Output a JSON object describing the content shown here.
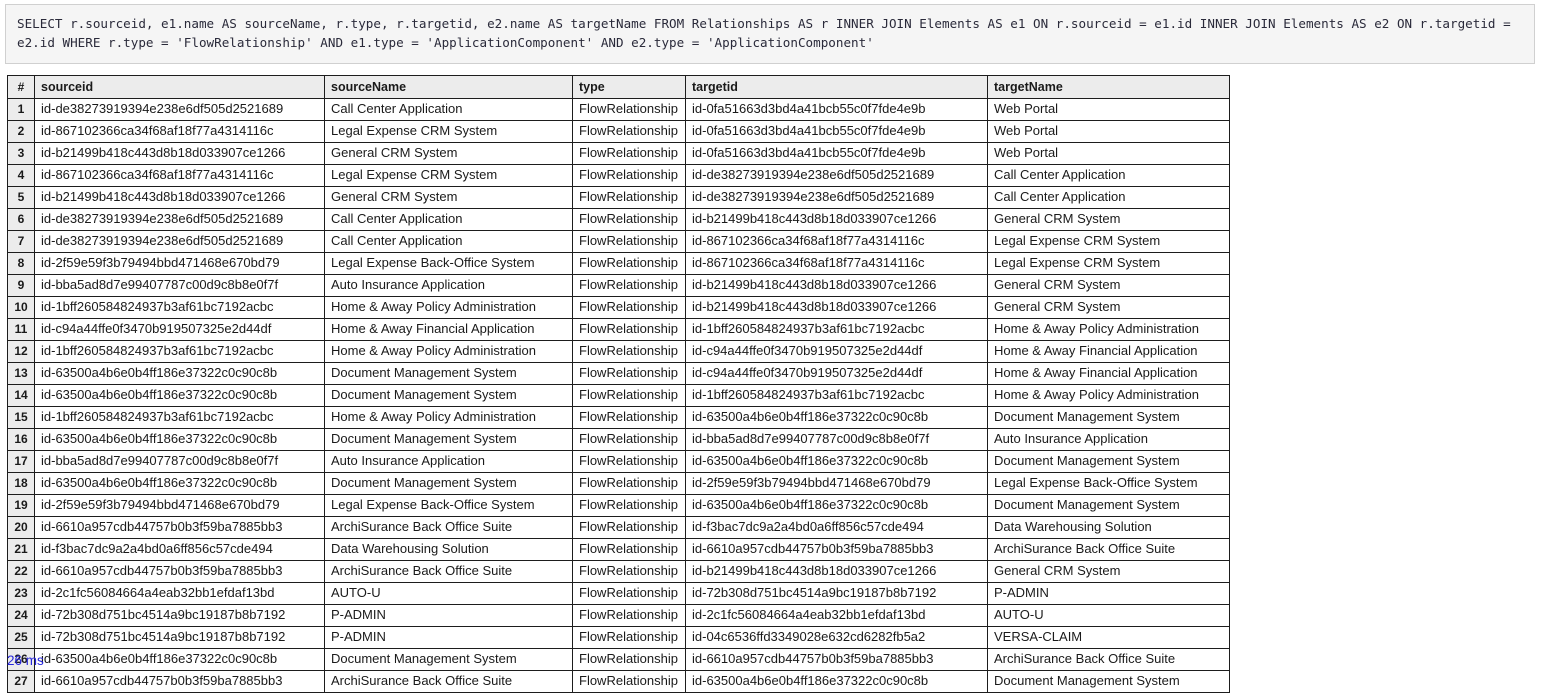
{
  "query": {
    "sql": "SELECT r.sourceid, e1.name AS sourceName, r.type, r.targetid, e2.name AS targetName FROM Relationships AS r INNER JOIN Elements AS e1 ON r.sourceid = e1.id INNER JOIN Elements AS e2 ON r.targetid = e2.id WHERE r.type = 'FlowRelationship' AND e1.type = 'ApplicationComponent' AND e2.type = 'ApplicationComponent'"
  },
  "results": {
    "columns": [
      "#",
      "sourceid",
      "sourceName",
      "type",
      "targetid",
      "targetName"
    ],
    "rows": [
      [
        "1",
        "id-de38273919394e238e6df505d2521689",
        "Call Center Application",
        "FlowRelationship",
        "id-0fa51663d3bd4a41bcb55c0f7fde4e9b",
        "Web Portal"
      ],
      [
        "2",
        "id-867102366ca34f68af18f77a4314116c",
        "Legal Expense CRM System",
        "FlowRelationship",
        "id-0fa51663d3bd4a41bcb55c0f7fde4e9b",
        "Web Portal"
      ],
      [
        "3",
        "id-b21499b418c443d8b18d033907ce1266",
        "General CRM System",
        "FlowRelationship",
        "id-0fa51663d3bd4a41bcb55c0f7fde4e9b",
        "Web Portal"
      ],
      [
        "4",
        "id-867102366ca34f68af18f77a4314116c",
        "Legal Expense CRM System",
        "FlowRelationship",
        "id-de38273919394e238e6df505d2521689",
        "Call Center Application"
      ],
      [
        "5",
        "id-b21499b418c443d8b18d033907ce1266",
        "General CRM System",
        "FlowRelationship",
        "id-de38273919394e238e6df505d2521689",
        "Call Center Application"
      ],
      [
        "6",
        "id-de38273919394e238e6df505d2521689",
        "Call Center Application",
        "FlowRelationship",
        "id-b21499b418c443d8b18d033907ce1266",
        "General CRM System"
      ],
      [
        "7",
        "id-de38273919394e238e6df505d2521689",
        "Call Center Application",
        "FlowRelationship",
        "id-867102366ca34f68af18f77a4314116c",
        "Legal Expense CRM System"
      ],
      [
        "8",
        "id-2f59e59f3b79494bbd471468e670bd79",
        "Legal Expense Back-Office System",
        "FlowRelationship",
        "id-867102366ca34f68af18f77a4314116c",
        "Legal Expense CRM System"
      ],
      [
        "9",
        "id-bba5ad8d7e99407787c00d9c8b8e0f7f",
        "Auto Insurance Application",
        "FlowRelationship",
        "id-b21499b418c443d8b18d033907ce1266",
        "General CRM System"
      ],
      [
        "10",
        "id-1bff260584824937b3af61bc7192acbc",
        "Home & Away Policy Administration",
        "FlowRelationship",
        "id-b21499b418c443d8b18d033907ce1266",
        "General CRM System"
      ],
      [
        "11",
        "id-c94a44ffe0f3470b919507325e2d44df",
        "Home & Away Financial Application",
        "FlowRelationship",
        "id-1bff260584824937b3af61bc7192acbc",
        "Home & Away Policy Administration"
      ],
      [
        "12",
        "id-1bff260584824937b3af61bc7192acbc",
        "Home & Away Policy Administration",
        "FlowRelationship",
        "id-c94a44ffe0f3470b919507325e2d44df",
        "Home & Away Financial Application"
      ],
      [
        "13",
        "id-63500a4b6e0b4ff186e37322c0c90c8b",
        "Document Management System",
        "FlowRelationship",
        "id-c94a44ffe0f3470b919507325e2d44df",
        "Home & Away Financial Application"
      ],
      [
        "14",
        "id-63500a4b6e0b4ff186e37322c0c90c8b",
        "Document Management System",
        "FlowRelationship",
        "id-1bff260584824937b3af61bc7192acbc",
        "Home & Away Policy Administration"
      ],
      [
        "15",
        "id-1bff260584824937b3af61bc7192acbc",
        "Home & Away Policy Administration",
        "FlowRelationship",
        "id-63500a4b6e0b4ff186e37322c0c90c8b",
        "Document Management System"
      ],
      [
        "16",
        "id-63500a4b6e0b4ff186e37322c0c90c8b",
        "Document Management System",
        "FlowRelationship",
        "id-bba5ad8d7e99407787c00d9c8b8e0f7f",
        "Auto Insurance Application"
      ],
      [
        "17",
        "id-bba5ad8d7e99407787c00d9c8b8e0f7f",
        "Auto Insurance Application",
        "FlowRelationship",
        "id-63500a4b6e0b4ff186e37322c0c90c8b",
        "Document Management System"
      ],
      [
        "18",
        "id-63500a4b6e0b4ff186e37322c0c90c8b",
        "Document Management System",
        "FlowRelationship",
        "id-2f59e59f3b79494bbd471468e670bd79",
        "Legal Expense Back-Office System"
      ],
      [
        "19",
        "id-2f59e59f3b79494bbd471468e670bd79",
        "Legal Expense Back-Office System",
        "FlowRelationship",
        "id-63500a4b6e0b4ff186e37322c0c90c8b",
        "Document Management System"
      ],
      [
        "20",
        "id-6610a957cdb44757b0b3f59ba7885bb3",
        "ArchiSurance Back Office Suite",
        "FlowRelationship",
        "id-f3bac7dc9a2a4bd0a6ff856c57cde494",
        "Data Warehousing Solution"
      ],
      [
        "21",
        "id-f3bac7dc9a2a4bd0a6ff856c57cde494",
        "Data Warehousing Solution",
        "FlowRelationship",
        "id-6610a957cdb44757b0b3f59ba7885bb3",
        "ArchiSurance Back Office Suite"
      ],
      [
        "22",
        "id-6610a957cdb44757b0b3f59ba7885bb3",
        "ArchiSurance Back Office Suite",
        "FlowRelationship",
        "id-b21499b418c443d8b18d033907ce1266",
        "General CRM System"
      ],
      [
        "23",
        "id-2c1fc56084664a4eab32bb1efdaf13bd",
        "AUTO-U",
        "FlowRelationship",
        "id-72b308d751bc4514a9bc19187b8b7192",
        "P-ADMIN"
      ],
      [
        "24",
        "id-72b308d751bc4514a9bc19187b8b7192",
        "P-ADMIN",
        "FlowRelationship",
        "id-2c1fc56084664a4eab32bb1efdaf13bd",
        "AUTO-U"
      ],
      [
        "25",
        "id-72b308d751bc4514a9bc19187b8b7192",
        "P-ADMIN",
        "FlowRelationship",
        "id-04c6536ffd3349028e632cd6282fb5a2",
        "VERSA-CLAIM"
      ],
      [
        "26",
        "id-63500a4b6e0b4ff186e37322c0c90c8b",
        "Document Management System",
        "FlowRelationship",
        "id-6610a957cdb44757b0b3f59ba7885bb3",
        "ArchiSurance Back Office Suite"
      ],
      [
        "27",
        "id-6610a957cdb44757b0b3f59ba7885bb3",
        "ArchiSurance Back Office Suite",
        "FlowRelationship",
        "id-63500a4b6e0b4ff186e37322c0c90c8b",
        "Document Management System"
      ]
    ]
  },
  "footer": {
    "elapsed": "26 ms"
  },
  "colors": {
    "header_background": "#ececec",
    "sql_background": "#f5f5f5",
    "border": "#1d1d1d",
    "footer_text": "#2727dd"
  }
}
